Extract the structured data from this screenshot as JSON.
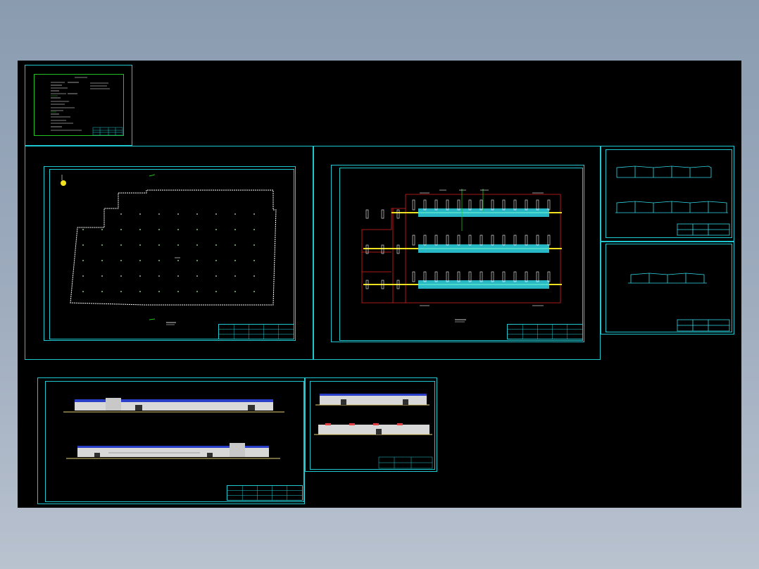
{
  "viewport": {
    "background": "#000000"
  },
  "colors": {
    "frame": "#1fc8d0",
    "green_frame": "#22c022",
    "plan_outline": "#ffffff",
    "grid_red": "#e02020",
    "band_yellow": "#f0e020",
    "band_cyan": "#30d8e8",
    "roof_blue": "#2a3fc8",
    "ground": "#e8d27a"
  },
  "sheets": [
    {
      "id": "notes-sheet",
      "content": "design-notes"
    },
    {
      "id": "site-plan-sheet",
      "content": "column-grid-plan"
    },
    {
      "id": "floor-plan-sheet",
      "content": "structural-floor-plan"
    },
    {
      "id": "section-sheet-1",
      "content": "sections"
    },
    {
      "id": "section-sheet-2",
      "content": "section"
    },
    {
      "id": "elevation-sheet-1",
      "content": "elevations"
    },
    {
      "id": "elevation-sheet-2",
      "content": "elevations"
    }
  ]
}
